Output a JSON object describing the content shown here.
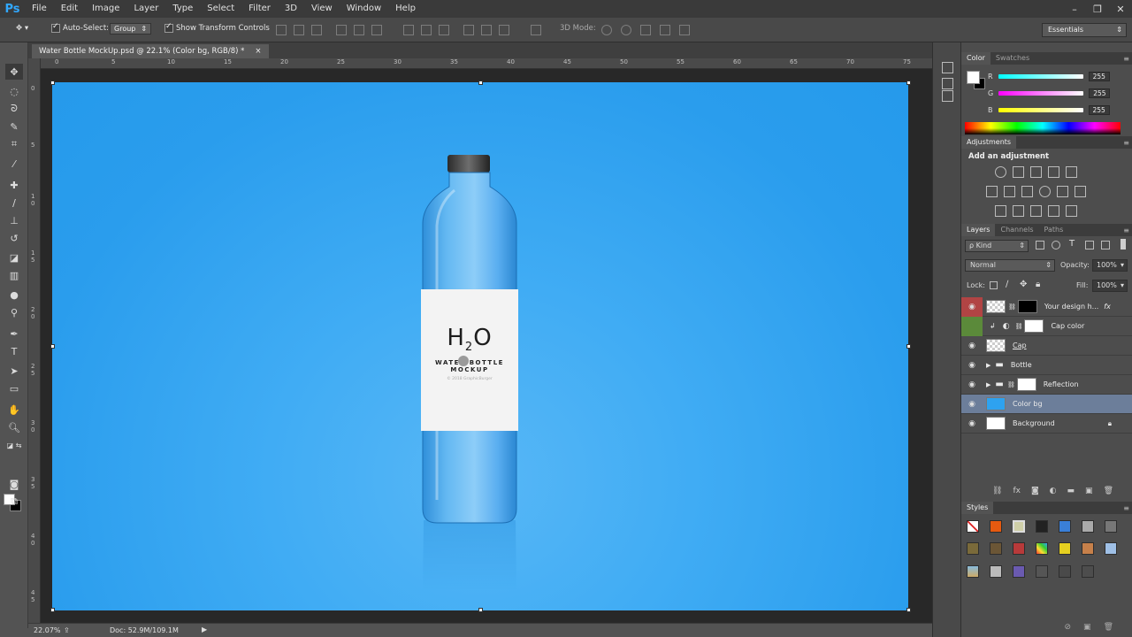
{
  "app": {
    "logo": "Ps"
  },
  "menu": [
    "File",
    "Edit",
    "Image",
    "Layer",
    "Type",
    "Select",
    "Filter",
    "3D",
    "View",
    "Window",
    "Help"
  ],
  "window_controls": [
    "–",
    "❐",
    "✕"
  ],
  "options_bar": {
    "auto_select_label": "Auto-Select:",
    "auto_select_value": "Group",
    "show_transform_label": "Show Transform Controls",
    "mode_3d_label": "3D Mode:",
    "workspace": "Essentials"
  },
  "document": {
    "tab_title": "Water Bottle MockUp.psd @ 22.1% (Color bg, RGB/8) *",
    "tab_close": "×"
  },
  "ruler": {
    "top_ticks": [
      "0",
      "5",
      "10",
      "15",
      "20",
      "25",
      "30",
      "35",
      "40",
      "45",
      "50",
      "55",
      "60",
      "65",
      "70",
      "75"
    ],
    "left_ticks": [
      "0",
      "5",
      "1\n0",
      "1\n5",
      "2\n0",
      "2\n5",
      "3\n0",
      "3\n5",
      "4\n0",
      "4\n5"
    ]
  },
  "canvas": {
    "bottle_title": "H",
    "bottle_title_sub": "2",
    "bottle_title_end": "O",
    "bottle_line1": "WATER BOTTLE",
    "bottle_line2": "MOCKUP",
    "bottle_copyright": "© 2018 GraphicBurger",
    "bg_color": "#2ea2f0"
  },
  "status": {
    "zoom": "22.07%",
    "doc": "Doc: 52.9M/109.1M"
  },
  "color_panel": {
    "tabs": [
      "Color",
      "Swatches"
    ],
    "channels": [
      {
        "label": "R",
        "value": "255",
        "gradient": "linear-gradient(to right, #00ffff, #ffffff)"
      },
      {
        "label": "G",
        "value": "255",
        "gradient": "linear-gradient(to right, #ff00ff, #ffffff)"
      },
      {
        "label": "B",
        "value": "255",
        "gradient": "linear-gradient(to right, #ffff00, #ffffff)"
      }
    ]
  },
  "adjustments_panel": {
    "tab": "Adjustments",
    "heading": "Add an adjustment"
  },
  "layers_panel": {
    "tabs": [
      "Layers",
      "Channels",
      "Paths"
    ],
    "filter_kind": "ρ Kind",
    "blend_mode": "Normal",
    "opacity_label": "Opacity:",
    "opacity_value": "100%",
    "lock_label": "Lock:",
    "fill_label": "Fill:",
    "fill_value": "100%",
    "layers": [
      {
        "name": "Your design h...",
        "fx": "fx"
      },
      {
        "name": "Cap color"
      },
      {
        "name": "Cap"
      },
      {
        "name": "Bottle"
      },
      {
        "name": "Reflection"
      },
      {
        "name": "Color bg"
      },
      {
        "name": "Background"
      }
    ]
  },
  "styles_panel": {
    "tab": "Styles"
  },
  "colors": {
    "selected_layer": "#6c7e9a",
    "accent": "#31a8ff"
  }
}
